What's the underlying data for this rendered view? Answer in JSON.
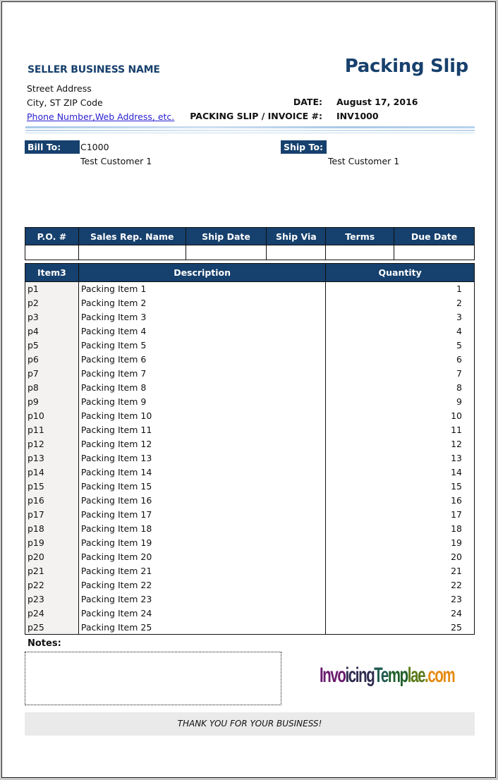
{
  "header": {
    "seller_name": "SELLER BUSINESS NAME",
    "title": "Packing Slip",
    "address": [
      "Street Address",
      "City, ST  ZIP Code"
    ],
    "contact_link": "Phone Number,Web Address, etc.",
    "date_label": "DATE:",
    "date_value": "August 17, 2016",
    "invoice_label": "PACKING SLIP / INVOICE #:",
    "invoice_value": "INV1000"
  },
  "bill_to": {
    "label": "Bill To:",
    "customer_id": "C1000",
    "name": "Test Customer 1"
  },
  "ship_to": {
    "label": "Ship To:",
    "name": "Test Customer 1"
  },
  "info_table": {
    "headers": [
      "P.O. #",
      "Sales Rep. Name",
      "Ship Date",
      "Ship Via",
      "Terms",
      "Due Date"
    ],
    "values": [
      "",
      "",
      "",
      "",
      "",
      ""
    ]
  },
  "items_table": {
    "headers": [
      "Item3",
      "Description",
      "Quantity"
    ],
    "rows": [
      {
        "code": "p1",
        "desc": "Packing Item 1",
        "qty": "1"
      },
      {
        "code": "p2",
        "desc": "Packing Item 2",
        "qty": "2"
      },
      {
        "code": "p3",
        "desc": "Packing Item 3",
        "qty": "3"
      },
      {
        "code": "p4",
        "desc": "Packing Item 4",
        "qty": "4"
      },
      {
        "code": "p5",
        "desc": "Packing Item 5",
        "qty": "5"
      },
      {
        "code": "p6",
        "desc": "Packing Item 6",
        "qty": "6"
      },
      {
        "code": "p7",
        "desc": "Packing Item 7",
        "qty": "7"
      },
      {
        "code": "p8",
        "desc": "Packing Item 8",
        "qty": "8"
      },
      {
        "code": "p9",
        "desc": "Packing Item 9",
        "qty": "9"
      },
      {
        "code": "p10",
        "desc": "Packing Item 10",
        "qty": "10"
      },
      {
        "code": "p11",
        "desc": "Packing Item 11",
        "qty": "11"
      },
      {
        "code": "p12",
        "desc": "Packing Item 12",
        "qty": "12"
      },
      {
        "code": "p13",
        "desc": "Packing Item 13",
        "qty": "13"
      },
      {
        "code": "p14",
        "desc": "Packing Item 14",
        "qty": "14"
      },
      {
        "code": "p15",
        "desc": "Packing Item 15",
        "qty": "15"
      },
      {
        "code": "p16",
        "desc": "Packing Item 16",
        "qty": "16"
      },
      {
        "code": "p17",
        "desc": "Packing Item 17",
        "qty": "17"
      },
      {
        "code": "p18",
        "desc": "Packing Item 18",
        "qty": "18"
      },
      {
        "code": "p19",
        "desc": "Packing Item 19",
        "qty": "19"
      },
      {
        "code": "p20",
        "desc": "Packing Item 20",
        "qty": "20"
      },
      {
        "code": "p21",
        "desc": "Packing Item 21",
        "qty": "21"
      },
      {
        "code": "p22",
        "desc": "Packing Item 22",
        "qty": "22"
      },
      {
        "code": "p23",
        "desc": "Packing Item 23",
        "qty": "23"
      },
      {
        "code": "p24",
        "desc": "Packing Item 24",
        "qty": "24"
      },
      {
        "code": "p25",
        "desc": "Packing Item 25",
        "qty": "25"
      }
    ]
  },
  "notes": {
    "label": "Notes:",
    "value": ""
  },
  "logo": {
    "text": "InvoicingTemplae.com",
    "segments": [
      {
        "text": "Invo",
        "color": "#6b1a6e"
      },
      {
        "text": "icing",
        "color": "#2c2a4e"
      },
      {
        "text": "Te",
        "color": "#1f5a50"
      },
      {
        "text": "mp",
        "color": "#1e5f2a"
      },
      {
        "text": "lae",
        "color": "#5a7a1a"
      },
      {
        "text": ".",
        "color": "#9a8a10"
      },
      {
        "text": "com",
        "color": "#e58a12"
      }
    ]
  },
  "footer": {
    "thanks": "THANK YOU FOR YOUR BUSINESS!"
  },
  "colors": {
    "accent": "#16406d",
    "link": "#2a1fcf",
    "footer_bg": "#ebeaea",
    "item_col_bg": "#f3f2f0"
  }
}
